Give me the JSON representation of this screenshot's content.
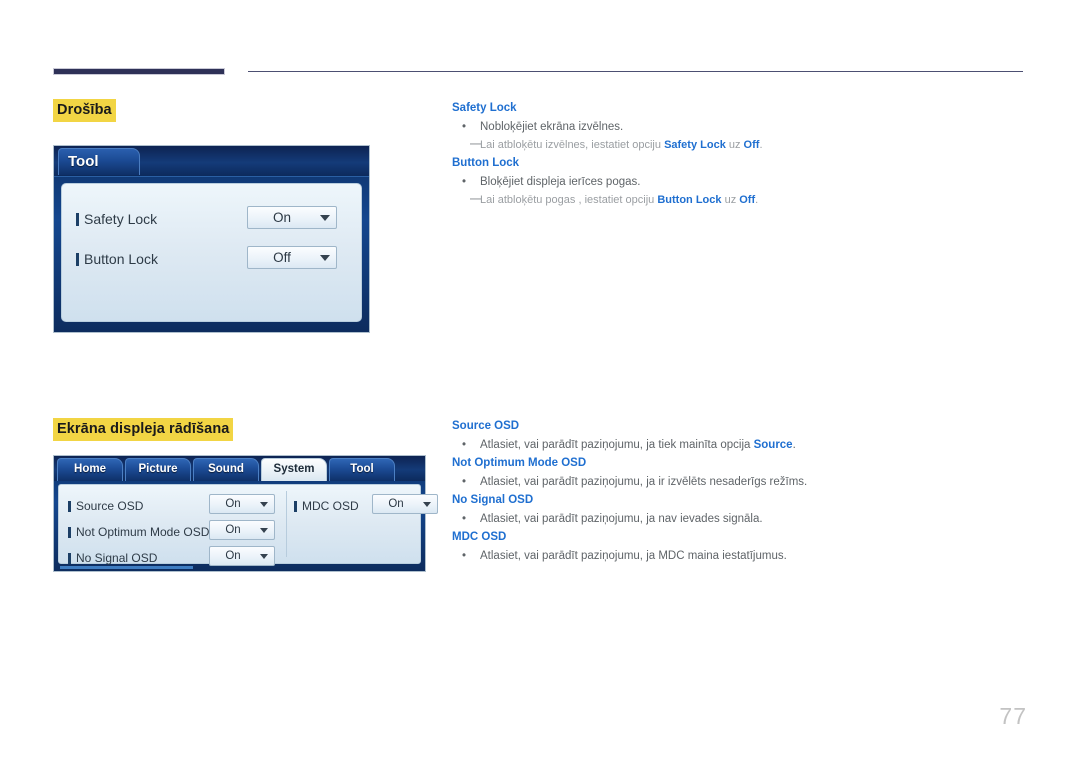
{
  "page": {
    "number": "77"
  },
  "sections": [
    {
      "heading": "Drošība",
      "osd": {
        "type": "single-tab",
        "title": "Tool",
        "rows": [
          {
            "label": "Safety Lock",
            "value": "On"
          },
          {
            "label": "Button Lock",
            "value": "Off"
          }
        ]
      },
      "text": [
        {
          "head": "Safety Lock",
          "bullet": "Nobloķējiet ekrāna izvēlnes.",
          "note_prefix": "Lai atbloķētu izvēlnes, iestatiet opciju ",
          "note_kw1": "Safety Lock",
          "note_mid": " uz ",
          "note_kw2": "Off",
          "note_suffix": "."
        },
        {
          "head": "Button Lock",
          "bullet": "Bloķējiet displeja ierīces pogas.",
          "note_prefix": "Lai atbloķētu pogas , iestatiet opciju ",
          "note_kw1": "Button Lock",
          "note_mid": " uz ",
          "note_kw2": "Off",
          "note_suffix": "."
        }
      ]
    },
    {
      "heading": "Ekrāna displeja rādīšana",
      "osd": {
        "type": "tabbed",
        "tabs": [
          {
            "label": "Home",
            "selected": false
          },
          {
            "label": "Picture",
            "selected": false
          },
          {
            "label": "Sound",
            "selected": false
          },
          {
            "label": "System",
            "selected": true
          },
          {
            "label": "Tool",
            "selected": false
          }
        ],
        "rows_left": [
          {
            "label": "Source OSD",
            "value": "On"
          },
          {
            "label": "Not Optimum Mode OSD",
            "value": "On"
          },
          {
            "label": "No Signal OSD",
            "value": "On"
          }
        ],
        "rows_right": [
          {
            "label": "MDC OSD",
            "value": "On"
          }
        ]
      },
      "text": [
        {
          "head": "Source OSD",
          "bullet_prefix": "Atlasiet, vai parādīt paziņojumu, ja tiek mainīta opcija ",
          "bullet_kw": "Source",
          "bullet_suffix": "."
        },
        {
          "head": "Not Optimum Mode OSD",
          "bullet": "Atlasiet, vai parādīt paziņojumu, ja ir izvēlēts nesaderīgs režīms."
        },
        {
          "head": "No Signal OSD",
          "bullet": "Atlasiet, vai parādīt paziņojumu, ja nav ievades signāla."
        },
        {
          "head": "MDC OSD",
          "bullet": "Atlasiet, vai parādīt paziņojumu, ja MDC maina iestatījumus."
        }
      ]
    }
  ],
  "colors": {
    "heading_highlight": "#f2d544",
    "link_blue": "#1f6fd0",
    "rule_navy": "#2e3157",
    "body_gray": "#5f6468",
    "note_gray": "#9a9ea2"
  },
  "icons": {
    "caret": "chevron-down-icon",
    "bullet": "bullet-dot-icon",
    "row_marker": "row-marker-icon",
    "note_dash": "note-dash-icon"
  }
}
